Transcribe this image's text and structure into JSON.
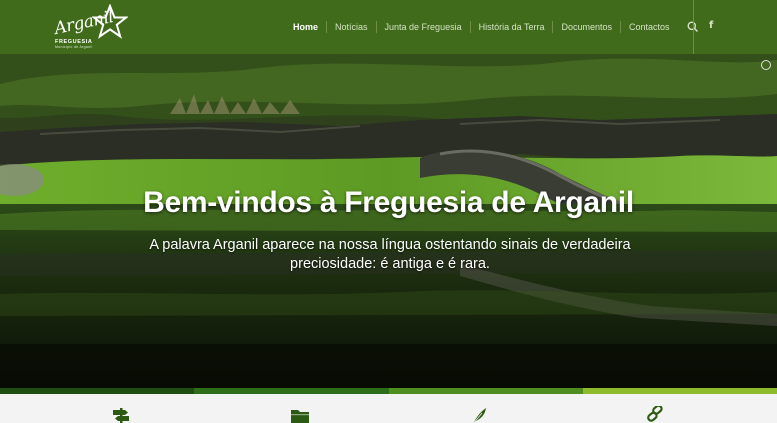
{
  "site": {
    "logo_script": "Arganil",
    "logo_freguesia": "FREGUESIA",
    "logo_tagline": "Município de Arganil"
  },
  "nav": {
    "items": [
      {
        "label": "Home",
        "active": true
      },
      {
        "label": "Notícias",
        "active": false
      },
      {
        "label": "Junta de Freguesia",
        "active": false
      },
      {
        "label": "História da Terra",
        "active": false
      },
      {
        "label": "Documentos",
        "active": false
      },
      {
        "label": "Contactos",
        "active": false
      }
    ],
    "search_icon": "search-icon",
    "social_label": "f",
    "social_icon": "facebook-icon"
  },
  "hero": {
    "title": "Bem-vindos à Freguesia de Arganil",
    "subtitle": "A palavra Arganil aparece na nossa língua ostentando sinais de verdadeira preciosidade: é antiga e é rara."
  },
  "strip_colors": [
    "#1f4d12",
    "#2d6e1a",
    "#4f8f1f",
    "#8dbb2c"
  ],
  "colors": {
    "header_bg": "#3f6b1a",
    "accent": "#8dbb2c"
  },
  "features": [
    {
      "icon": "signpost-icon"
    },
    {
      "icon": "folder-icon"
    },
    {
      "icon": "feather-icon"
    },
    {
      "icon": "link-icon"
    }
  ]
}
